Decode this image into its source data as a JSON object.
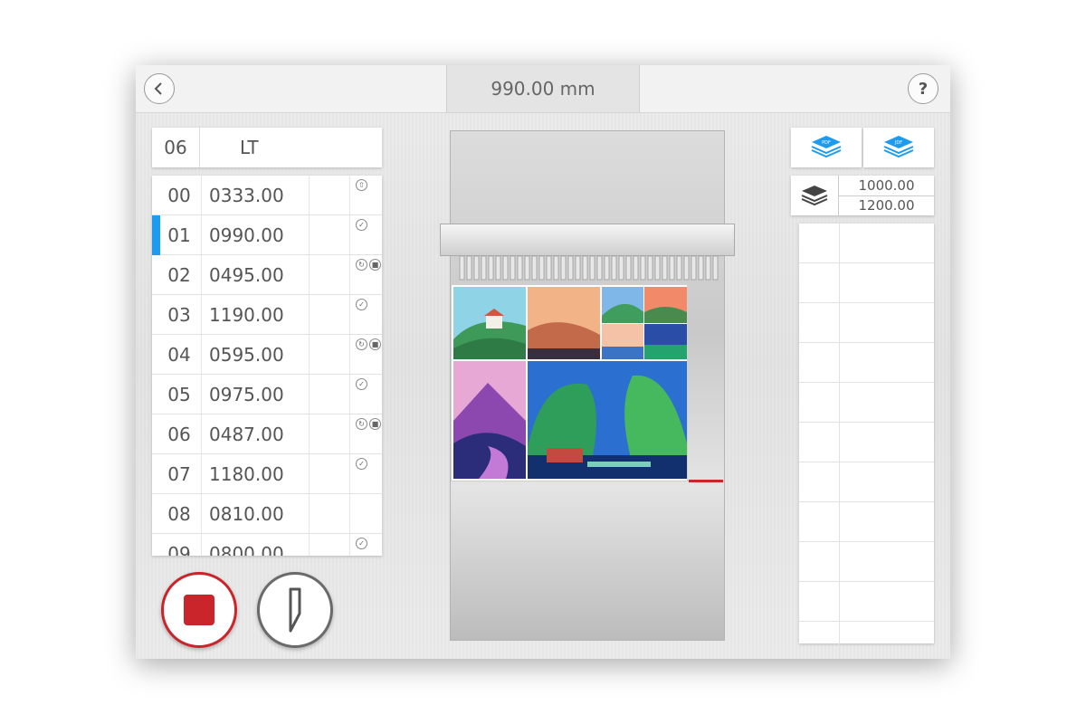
{
  "header": {
    "back_icon": "chevron-left-icon",
    "measurement": "990.00 mm",
    "help_label": "?"
  },
  "program": {
    "number": "06",
    "name": "LT"
  },
  "cuts": [
    {
      "index": "00",
      "value": "0333.00",
      "icons": [
        "pusher"
      ]
    },
    {
      "index": "01",
      "value": "0990.00",
      "icons": [
        "knife"
      ],
      "selected": true
    },
    {
      "index": "02",
      "value": "0495.00",
      "icons": [
        "rotate",
        "clamp"
      ]
    },
    {
      "index": "03",
      "value": "1190.00",
      "icons": [
        "knife"
      ]
    },
    {
      "index": "04",
      "value": "0595.00",
      "icons": [
        "rotate",
        "clamp"
      ]
    },
    {
      "index": "05",
      "value": "0975.00",
      "icons": [
        "knife"
      ]
    },
    {
      "index": "06",
      "value": "0487.00",
      "icons": [
        "rotate",
        "clamp"
      ]
    },
    {
      "index": "07",
      "value": "1180.00",
      "icons": [
        "knife"
      ]
    },
    {
      "index": "08",
      "value": "0810.00",
      "icons": []
    },
    {
      "index": "09",
      "value": "0800.00",
      "icons": [
        "knife"
      ]
    }
  ],
  "controls": {
    "stop_icon": "stop-icon",
    "knife_icon": "knife-blade-icon"
  },
  "right_panel": {
    "pdf_label": "PDF",
    "jdf_label": "JDF",
    "sheet_width": "1000.00",
    "sheet_height": "1200.00"
  },
  "colors": {
    "accent_blue": "#1d9bf0",
    "stop_red": "#c9252b"
  }
}
